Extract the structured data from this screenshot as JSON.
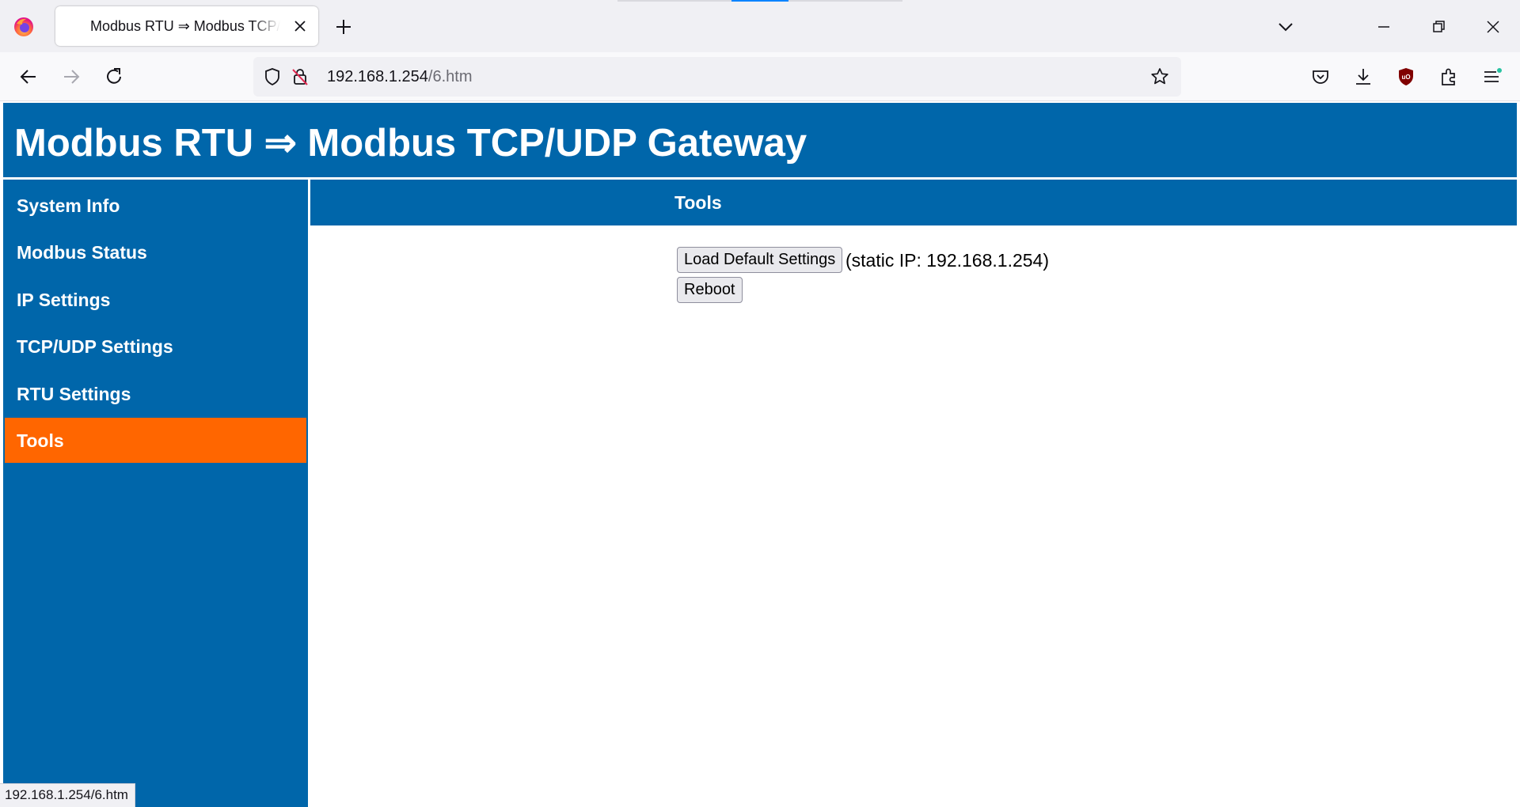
{
  "browser": {
    "tab_title": "Modbus RTU ⇒ Modbus TCP/UDP Gateway",
    "url_host": "192.168.1.254",
    "url_path": "/6.htm",
    "status_url": "192.168.1.254/6.htm",
    "icons": [
      "firefox-icon",
      "close-icon",
      "plus-icon",
      "chevron-down-icon",
      "minimize-icon",
      "restore-icon",
      "back-icon",
      "forward-icon",
      "reload-icon",
      "shield-icon",
      "insecure-lock-icon",
      "star-icon",
      "pocket-icon",
      "download-icon",
      "ublock-icon",
      "extensions-icon",
      "menu-icon"
    ]
  },
  "page": {
    "banner_title": "Modbus RTU ⇒ Modbus TCP/UDP Gateway",
    "sidebar": {
      "items": [
        {
          "label": "System Info",
          "active": false
        },
        {
          "label": "Modbus Status",
          "active": false
        },
        {
          "label": "IP Settings",
          "active": false
        },
        {
          "label": "TCP/UDP Settings",
          "active": false
        },
        {
          "label": "RTU Settings",
          "active": false
        },
        {
          "label": "Tools",
          "active": true
        }
      ]
    },
    "content": {
      "header": "Tools",
      "load_default_label": "Load Default Settings",
      "static_ip_note": "(static IP: 192.168.1.254)",
      "reboot_label": "Reboot"
    }
  },
  "colors": {
    "brand_blue": "#0066aa",
    "active_orange": "#ff6600"
  }
}
